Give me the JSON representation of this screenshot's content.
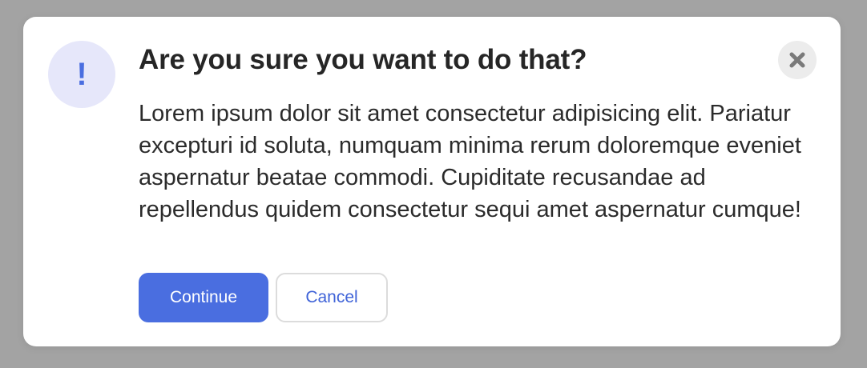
{
  "dialog": {
    "icon": "exclamation-icon",
    "icon_glyph": "!",
    "title": "Are you sure you want to do that?",
    "message": "Lorem ipsum dolor sit amet consectetur adipisicing elit. Pariatur excepturi id soluta, numquam minima rerum doloremque eveniet aspernatur beatae commodi. Cupiditate recusandae ad repellendus quidem consectetur sequi amet aspernatur cumque!",
    "close_icon": "close-icon",
    "actions": {
      "continue_label": "Continue",
      "cancel_label": "Cancel"
    }
  },
  "colors": {
    "accent": "#4a6ee0",
    "badge_bg": "#e6e7fa",
    "overlay": "#a3a3a3"
  }
}
